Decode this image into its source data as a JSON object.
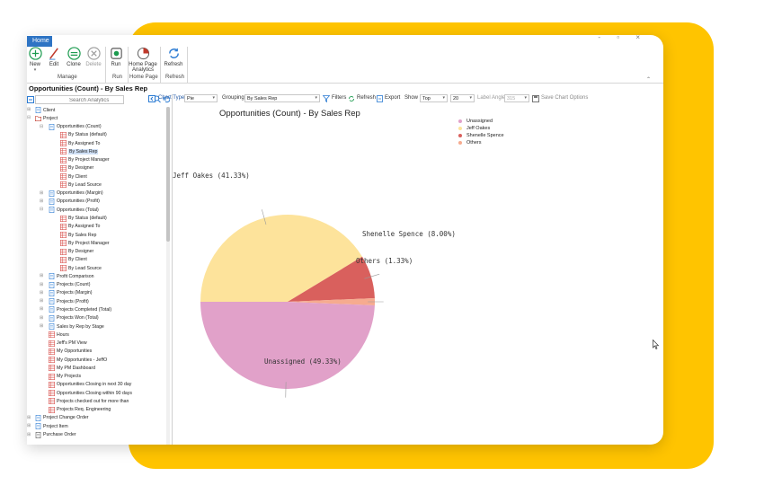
{
  "app": {
    "home_tab": "Home",
    "window_controls": "-  ▫  ×",
    "page_title": "Opportunities (Count) - By Sales Rep"
  },
  "ribbon": {
    "buttons": {
      "new": "New",
      "edit": "Edit",
      "clone": "Clone",
      "delete": "Delete",
      "run": "Run",
      "home_page_analytics": "Home Page Analytics",
      "refresh": "Refresh"
    },
    "groups": {
      "manage": "Manage",
      "run": "Run",
      "home_page": "Home Page",
      "refresh": "Refresh"
    },
    "new_caret": "▾"
  },
  "search": {
    "placeholder": "Search Analytics"
  },
  "tree": [
    {
      "label": "Client",
      "level": 0,
      "icon": "client-icon",
      "expander": "⊞"
    },
    {
      "label": "Project",
      "level": 0,
      "icon": "folder-icon",
      "expander": "⊟"
    },
    {
      "label": "Opportunities (Count)",
      "level": 1,
      "icon": "document-icon",
      "expander": "⊟"
    },
    {
      "label": "By Status (default)",
      "level": 2,
      "icon": "report-icon"
    },
    {
      "label": "By Assigned To",
      "level": 2,
      "icon": "report-icon"
    },
    {
      "label": "By Sales Rep",
      "level": 2,
      "icon": "report-icon",
      "selected": true
    },
    {
      "label": "By Project Manager",
      "level": 2,
      "icon": "report-icon"
    },
    {
      "label": "By Designer",
      "level": 2,
      "icon": "report-icon"
    },
    {
      "label": "By Client",
      "level": 2,
      "icon": "report-icon"
    },
    {
      "label": "By Lead Source",
      "level": 2,
      "icon": "report-icon"
    },
    {
      "label": "Opportunities (Margin)",
      "level": 1,
      "icon": "document-icon",
      "expander": "⊞"
    },
    {
      "label": "Opportunities (Profit)",
      "level": 1,
      "icon": "document-icon",
      "expander": "⊞"
    },
    {
      "label": "Opportunities (Total)",
      "level": 1,
      "icon": "document-icon",
      "expander": "⊟"
    },
    {
      "label": "By Status (default)",
      "level": 2,
      "icon": "report-icon"
    },
    {
      "label": "By Assigned To",
      "level": 2,
      "icon": "report-icon"
    },
    {
      "label": "By Sales Rep",
      "level": 2,
      "icon": "report-icon"
    },
    {
      "label": "By Project Manager",
      "level": 2,
      "icon": "report-icon"
    },
    {
      "label": "By Designer",
      "level": 2,
      "icon": "report-icon"
    },
    {
      "label": "By Client",
      "level": 2,
      "icon": "report-icon"
    },
    {
      "label": "By Lead Source",
      "level": 2,
      "icon": "report-icon"
    },
    {
      "label": "Profit Comparison",
      "level": 1,
      "icon": "document-icon",
      "expander": "⊞"
    },
    {
      "label": "Projects (Count)",
      "level": 1,
      "icon": "document-icon",
      "expander": "⊞"
    },
    {
      "label": "Projects (Margin)",
      "level": 1,
      "icon": "document-icon",
      "expander": "⊞"
    },
    {
      "label": "Projects (Profit)",
      "level": 1,
      "icon": "document-icon",
      "expander": "⊞"
    },
    {
      "label": "Projects Completed (Total)",
      "level": 1,
      "icon": "document-icon",
      "expander": "⊞"
    },
    {
      "label": "Projects Won (Total)",
      "level": 1,
      "icon": "document-icon",
      "expander": "⊞"
    },
    {
      "label": "Sales by Rep by Stage",
      "level": 1,
      "icon": "document-icon",
      "expander": "⊞"
    },
    {
      "label": "Hours",
      "level": 1,
      "icon": "report-icon"
    },
    {
      "label": "Jeff's PM View",
      "level": 1,
      "icon": "report-icon"
    },
    {
      "label": "My Opportunities",
      "level": 1,
      "icon": "report-icon"
    },
    {
      "label": "My Opportunities - JeffO",
      "level": 1,
      "icon": "report-icon"
    },
    {
      "label": "My PM Dashboard",
      "level": 1,
      "icon": "report-icon"
    },
    {
      "label": "My Projects",
      "level": 1,
      "icon": "report-icon"
    },
    {
      "label": "Opportunities Closing in next 30 day",
      "level": 1,
      "icon": "report-icon"
    },
    {
      "label": "Opportunities Closing within 90 days",
      "level": 1,
      "icon": "report-icon"
    },
    {
      "label": "Projects checked out for more than",
      "level": 1,
      "icon": "report-icon"
    },
    {
      "label": "Projects Req. Engineering",
      "level": 1,
      "icon": "report-icon"
    },
    {
      "label": "Project Change Order",
      "level": 0,
      "icon": "change-order-icon",
      "expander": "⊞"
    },
    {
      "label": "Project Item",
      "level": 0,
      "icon": "item-icon",
      "expander": "⊞"
    },
    {
      "label": "Purchase Order",
      "level": 0,
      "icon": "purchase-order-icon",
      "expander": "⊞"
    }
  ],
  "toolbar": {
    "chart_type_label": "Chart Type",
    "chart_type_value": "Pie",
    "grouping_label": "Grouping:",
    "grouping_value": "By Sales Rep",
    "filters": "Filters",
    "refresh": "Refresh",
    "export": "Export",
    "show_label": "Show",
    "show_value": "Top",
    "count_value": "20",
    "label_angle_label": "Label Angle",
    "label_angle_value": "315",
    "save_chart_options": "Save Chart Options",
    "caret": "▾"
  },
  "chart_data": {
    "type": "pie",
    "title": "Opportunities (Count) - By Sales Rep",
    "series": [
      {
        "name": "Unassigned",
        "value": 49.33,
        "label": "Unassigned (49.33%)",
        "color": "#e1a1c9"
      },
      {
        "name": "Jeff Oakes",
        "value": 41.33,
        "label": "Jeff Oakes (41.33%)",
        "color": "#fde39b"
      },
      {
        "name": "Shenelle Spence",
        "value": 8.0,
        "label": "Shenelle Spence (8.00%)",
        "color": "#d9605d"
      },
      {
        "name": "Others",
        "value": 1.33,
        "label": "Others (1.33%)",
        "color": "#f6ab8f"
      }
    ],
    "legend_position": "top-right"
  },
  "colors": {
    "backdrop_accent": "#ffc400",
    "home_tab": "#2e74c4",
    "selection": "#cfe0f6"
  }
}
